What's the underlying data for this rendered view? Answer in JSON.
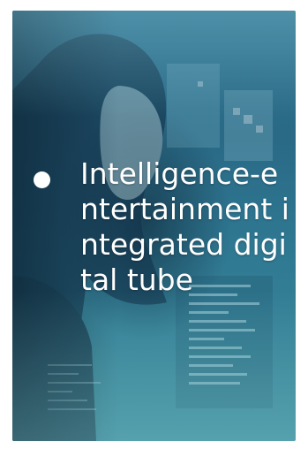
{
  "slide": {
    "bullet_text": "Intelligence-entertainment integrated digital tube",
    "background_image": "woman-with-holographic-screens-photo",
    "bullet_icon": "filled-circle-bullet",
    "colors": {
      "overlay": "#2e6f8d",
      "text": "#ffffff",
      "page": "#ffffff"
    }
  }
}
